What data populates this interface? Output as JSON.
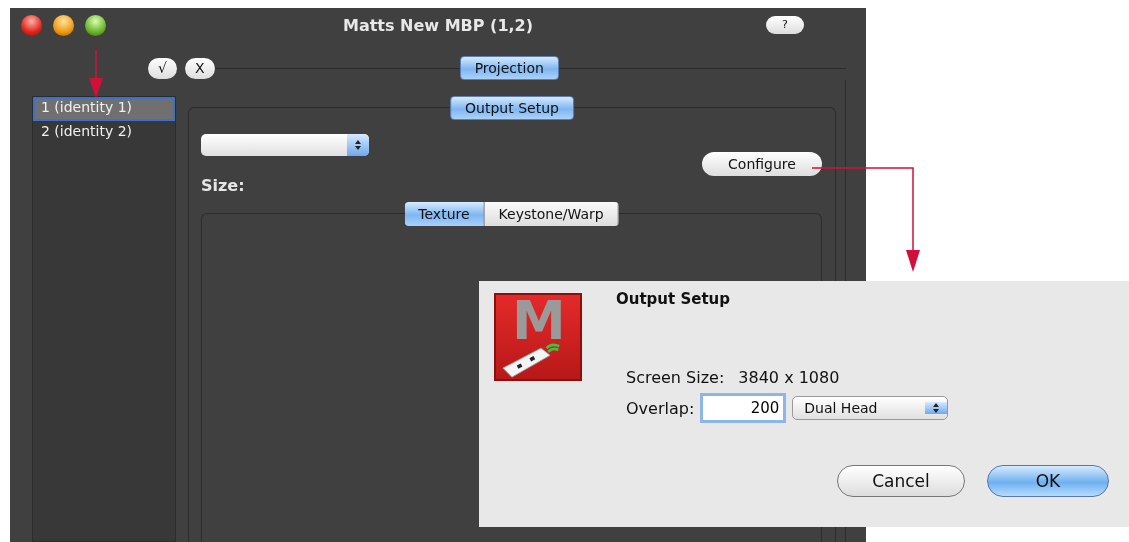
{
  "window": {
    "title": "Matts New MBP (1,2)",
    "help_button": "?"
  },
  "toolbar": {
    "confirm_button": "√",
    "cancel_button": "X"
  },
  "outputs": [
    {
      "label": "1 (identity 1)",
      "selected": true
    },
    {
      "label": "2 (identity 2)",
      "selected": false
    }
  ],
  "projection_tab": {
    "label": "Projection",
    "selected": true
  },
  "output_setup_tab": {
    "label": "Output Setup",
    "selected": true
  },
  "size_label": "Size:",
  "configure_button": "Configure",
  "segments": [
    {
      "label": "Texture",
      "selected": true
    },
    {
      "label": "Keystone/Warp",
      "selected": false
    }
  ],
  "dialog": {
    "logo_letter": "M",
    "title": "Output Setup",
    "screen_size_label": "Screen Size:",
    "screen_size_value": "3840 x 1080",
    "overlap_label": "Overlap:",
    "overlap_value": "200",
    "mode": "Dual Head",
    "buttons": [
      {
        "label": "Cancel",
        "default": false
      },
      {
        "label": "OK",
        "default": true
      }
    ]
  }
}
